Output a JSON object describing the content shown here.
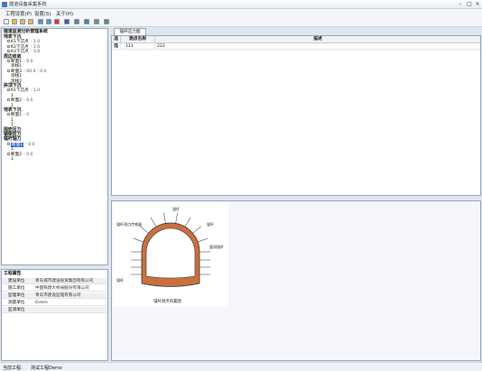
{
  "window": {
    "title": "隧道设备采集系统"
  },
  "menu": [
    {
      "label": "工程设置(P)"
    },
    {
      "label": "设置(S)"
    },
    {
      "label": "关于(H)"
    }
  ],
  "toolbar": {
    "buttons": [
      {
        "icon": "new-icon",
        "color": "#f2f4f7"
      },
      {
        "icon": "open-folder-icon",
        "color": "#e8b84a"
      },
      {
        "icon": "folder-icon",
        "color": "#e8b84a"
      },
      {
        "icon": "folder-up-icon",
        "color": "#e8b84a"
      },
      {
        "icon": "copy-icon",
        "color": "#5a8fd0"
      },
      {
        "icon": "paste-icon",
        "color": "#5a8fd0"
      },
      {
        "icon": "delete-icon",
        "color": "#d43a2a"
      },
      {
        "icon": "save-icon",
        "color": "#3b5fa8"
      },
      {
        "icon": "print-icon",
        "color": "#707a88"
      },
      {
        "icon": "export-icon",
        "color": "#4a7fc1"
      },
      {
        "icon": "settings-icon",
        "color": "#7a8593"
      },
      {
        "icon": "grid-icon",
        "color": "#4a9a5a"
      }
    ]
  },
  "tree": {
    "root": "隧道监测分析管理系统",
    "rows": [
      {
        "label": "地表下沉",
        "head": true,
        "indent": 0
      },
      {
        "label": "K1下沉点",
        "value": "- 1.0",
        "indent": 1,
        "ctrl": true
      },
      {
        "label": "K2下沉点",
        "value": "- 2.0",
        "indent": 1,
        "ctrl": true
      },
      {
        "label": "K3下沉点",
        "value": "- 3.0",
        "indent": 1,
        "ctrl": true
      },
      {
        "label": "周边收敛",
        "head": true,
        "indent": 0
      },
      {
        "label": "断面1",
        "value": "- 0.0",
        "indent": 1,
        "ctrl": true
      },
      {
        "label": "测线1",
        "value": "",
        "indent": 2
      },
      {
        "label": "断面2",
        "value": "- 00.0 - 0.0",
        "indent": 1,
        "ctrl": true
      },
      {
        "label": "测线1",
        "value": "",
        "indent": 2
      },
      {
        "label": "测线2",
        "value": "",
        "indent": 2
      },
      {
        "label": "拱顶下沉",
        "head": true,
        "indent": 0
      },
      {
        "label": "K1下沉点",
        "value": "- 1.0",
        "indent": 1,
        "ctrl": true
      },
      {
        "label": "1",
        "value": "",
        "indent": 2
      },
      {
        "label": "断面2",
        "value": "- 0.0",
        "indent": 1,
        "ctrl": true
      },
      {
        "label": "1",
        "value": "",
        "indent": 2
      },
      {
        "label": "地表下沉",
        "head": true,
        "indent": 0
      },
      {
        "label": "断面1",
        "value": "- 0",
        "indent": 1,
        "ctrl": true
      },
      {
        "label": "1",
        "value": "",
        "indent": 2
      },
      {
        "label": "1",
        "value": "",
        "indent": 2
      },
      {
        "label": "围岩压力",
        "head": true,
        "indent": 0
      },
      {
        "label": "钢架应力",
        "head": true,
        "indent": 0
      },
      {
        "label": "锚杆轴力",
        "head": true,
        "indent": 0
      },
      {
        "label": "断面1",
        "value": "- 0.0",
        "indent": 1,
        "ctrl": true,
        "selected": true
      },
      {
        "label": "1",
        "value": "",
        "indent": 2
      },
      {
        "label": "断面2",
        "value": "- 0.0",
        "indent": 1,
        "ctrl": true
      },
      {
        "label": "1",
        "value": "",
        "indent": 2
      }
    ]
  },
  "info": {
    "header": "工程属性",
    "rows": [
      {
        "key": "建设单位",
        "value": "青岛城市建设投资集团有限公司"
      },
      {
        "key": "施工单位",
        "value": "中国铁建大桥局股份有限公司"
      },
      {
        "key": "监理单位",
        "value": "青岛市建设监理有限公司"
      },
      {
        "key": "测量单位",
        "value": "Green"
      },
      {
        "key": "监测单位",
        "value": ""
      }
    ]
  },
  "tab": {
    "label": "锚杆应力图"
  },
  "table": {
    "columns": [
      "选择",
      "测点名称",
      "描述"
    ],
    "rows": [
      {
        "check": "",
        "name": "111",
        "desc": "222"
      }
    ]
  },
  "diagram": {
    "caption": "锚杆测点布置图",
    "labels": {
      "top": "锚杆",
      "upper_left": "锚杆测点传感器",
      "upper_right": "锚杆",
      "right": "量测锚杆",
      "bottom_left": "锚杆"
    },
    "colors": {
      "lining": "#c9703f",
      "outline": "#333333",
      "bolts": "#555555"
    }
  },
  "status": {
    "label": "当前工程：",
    "value": "测试工程Demo"
  }
}
